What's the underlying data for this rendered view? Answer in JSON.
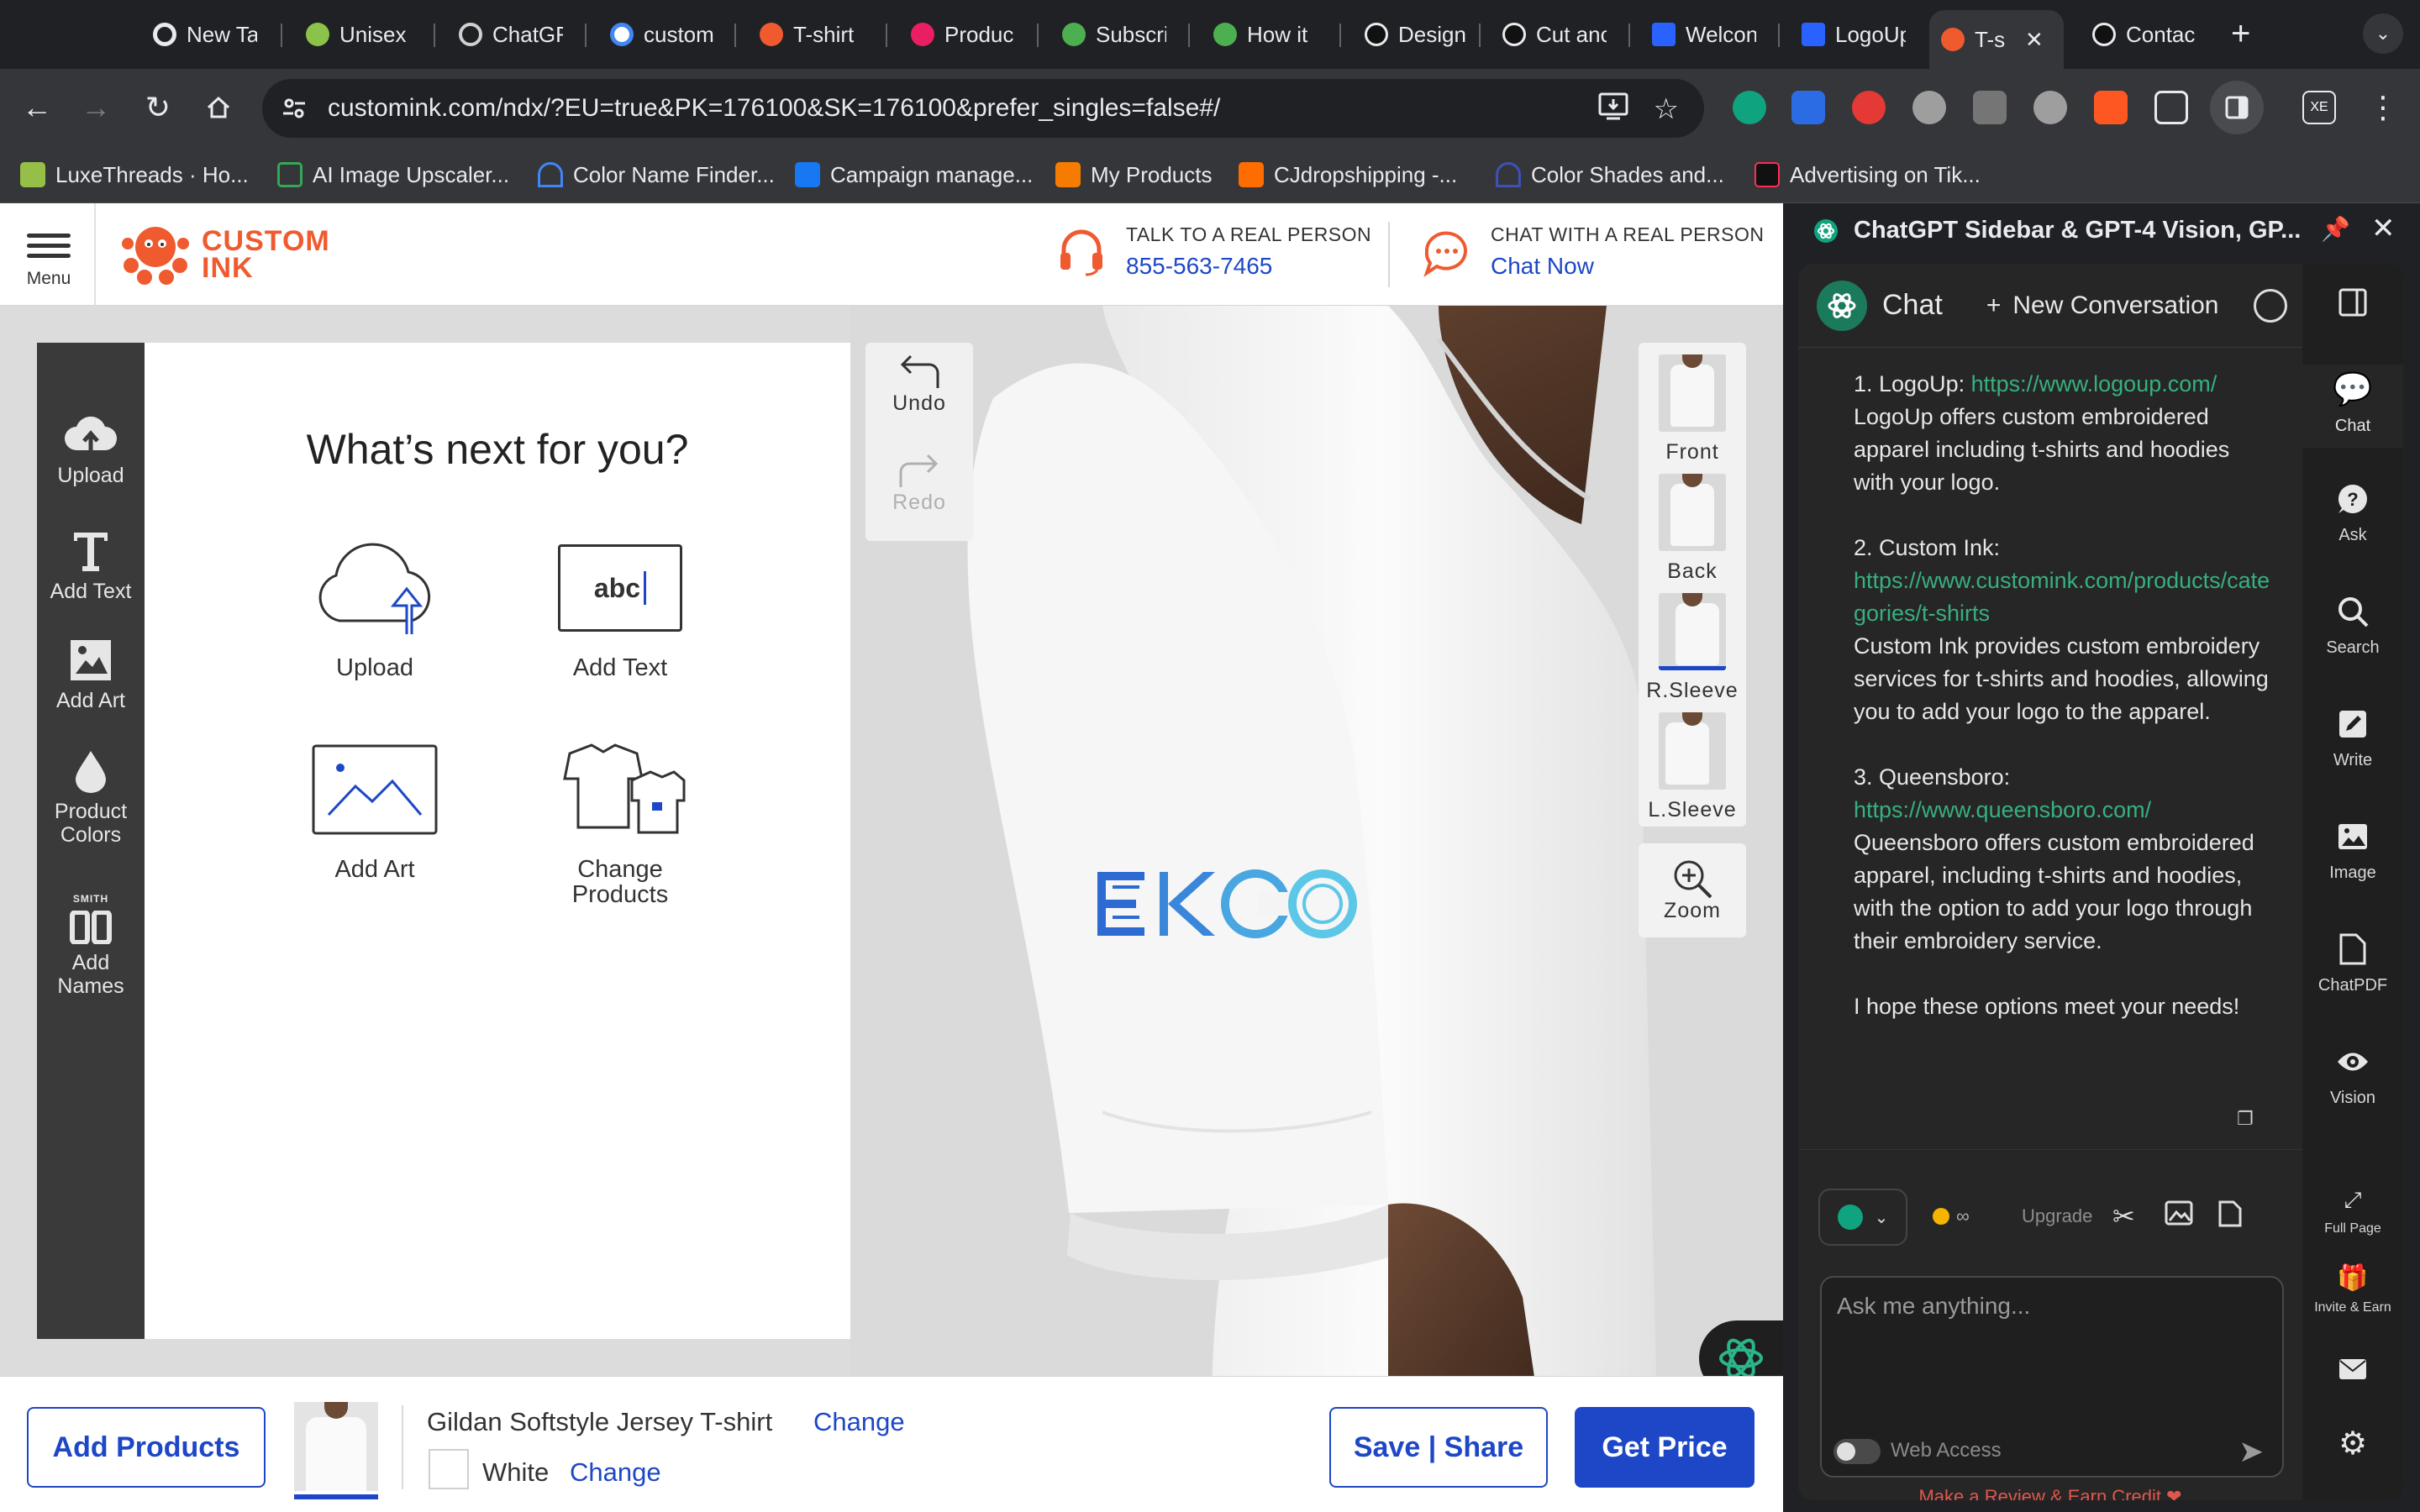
{
  "browser": {
    "tabs": [
      {
        "title": "New Ta",
        "color": "#e8eaed"
      },
      {
        "title": "Unisex",
        "color": "#8bc34a"
      },
      {
        "title": "ChatGF",
        "color": "#d0d0d0"
      },
      {
        "title": "custom",
        "color": "#4285f4"
      },
      {
        "title": "T-shirt",
        "color": "#ef5a2f"
      },
      {
        "title": "Produc",
        "color": "#e91e63"
      },
      {
        "title": "Subscri",
        "color": "#4caf50"
      },
      {
        "title": "How it",
        "color": "#4caf50"
      },
      {
        "title": "Design",
        "color": "#e8eaed"
      },
      {
        "title": "Cut anc",
        "color": "#e8eaed"
      },
      {
        "title": "Welcon",
        "color": "#2962ff"
      },
      {
        "title": "LogoUp",
        "color": "#2962ff"
      },
      {
        "title": "T-s",
        "color": "#ef5a2f",
        "active": true
      },
      {
        "title": "Contac",
        "color": "#e8eaed"
      }
    ],
    "url": "customink.com/ndx/?EU=true&PK=176100&SK=176100&prefer_singles=false#/",
    "bookmarks": [
      {
        "label": "LuxeThreads · Ho...",
        "color": "#95bf47"
      },
      {
        "label": "AI Image Upscaler...",
        "color": "#34a853"
      },
      {
        "label": "Color Name Finder...",
        "color": "#4285f4"
      },
      {
        "label": "Campaign manage...",
        "color": "#1877f2"
      },
      {
        "label": "My Products",
        "color": "#f57c00"
      },
      {
        "label": "CJdropshipping -...",
        "color": "#ff6d00"
      },
      {
        "label": "Color Shades and...",
        "color": "#3f51b5"
      },
      {
        "label": "Advertising on Tik...",
        "color": "#000000"
      }
    ]
  },
  "site": {
    "menu_label": "Menu",
    "logo_line1": "CUSTOM",
    "logo_line2": "INK",
    "talk_label": "TALK TO A REAL PERSON",
    "phone": "855-563-7465",
    "chat_label": "CHAT WITH A REAL PERSON",
    "chat_link": "Chat Now",
    "accent": "#1d47c6",
    "brand": "#ef5a2f"
  },
  "rail": {
    "upload": "Upload",
    "add_text": "Add Text",
    "add_art": "Add Art",
    "product_colors_1": "Product",
    "product_colors_2": "Colors",
    "smith": "SMITH",
    "add_names_1": "Add",
    "add_names_2": "Names"
  },
  "panel": {
    "heading": "What’s next for you?",
    "upload": "Upload",
    "add_text": "Add Text",
    "abc": "abc",
    "add_art": "Add Art",
    "change_products_1": "Change",
    "change_products_2": "Products"
  },
  "history": {
    "undo": "Undo",
    "redo": "Redo"
  },
  "views": {
    "front": "Front",
    "back": "Back",
    "rsleeve": "R.Sleeve",
    "lsleeve": "L.Sleeve",
    "zoom": "Zoom",
    "active": "rsleeve"
  },
  "design": {
    "logo_text": "EKCO"
  },
  "bottom": {
    "add_products": "Add Products",
    "product_name": "Gildan Softstyle Jersey T-shirt",
    "change": "Change",
    "color": "White",
    "color_change": "Change",
    "save_share": "Save | Share",
    "get_price": "Get Price"
  },
  "sidebar": {
    "title": "ChatGPT Sidebar & GPT-4 Vision, GP...",
    "chat_label": "Chat",
    "new_conversation": "New Conversation",
    "messages": {
      "m1_head": "1. LogoUp: ",
      "m1_link": "https://www.logoup.com/",
      "m1_body": "LogoUp offers custom embroidered apparel including t-shirts and hoodies with your logo.",
      "m2_head": "2. Custom Ink:",
      "m2_link": "https://www.customink.com/products/categories/t-shirts",
      "m2_body": "Custom Ink provides custom embroidery services for t-shirts and hoodies, allowing you to add your logo to the apparel.",
      "m3_head": "3. Queensboro:",
      "m3_link": "https://www.queensboro.com/",
      "m3_body": "Queensboro offers custom embroidered apparel, including t-shirts and hoodies, with the option to add your logo through their embroidery service.",
      "m4": "I hope these options meet your needs!"
    },
    "credits": "∞",
    "upgrade": "Upgrade",
    "placeholder": "Ask me anything...",
    "web_access": "Web Access",
    "review": "Make a Review & Earn Credit ❤",
    "rail": {
      "chat": "Chat",
      "ask": "Ask",
      "search": "Search",
      "write": "Write",
      "image": "Image",
      "chatpdf": "ChatPDF",
      "vision": "Vision",
      "full_page_1": "Full",
      "full_page_2": "Page",
      "invite": "Invite & Earn"
    }
  }
}
